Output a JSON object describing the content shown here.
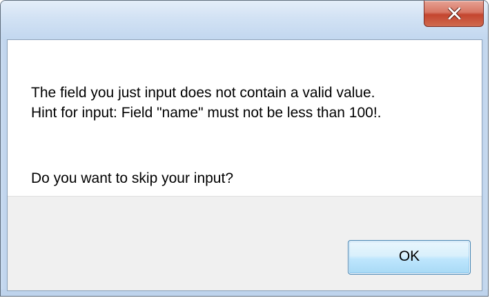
{
  "dialog": {
    "message_line1": "The field you just input does not contain a valid value.",
    "message_line2": "Hint for input: Field \"name\" must not be less than 100!.",
    "question": "Do you want to skip your input?"
  },
  "buttons": {
    "ok_label": "OK"
  },
  "titlebar": {
    "close_icon": "close-icon"
  },
  "colors": {
    "close_button": "#c4452f",
    "ok_button_border": "#3c7fb1",
    "button_bar": "#f0f0f0"
  }
}
